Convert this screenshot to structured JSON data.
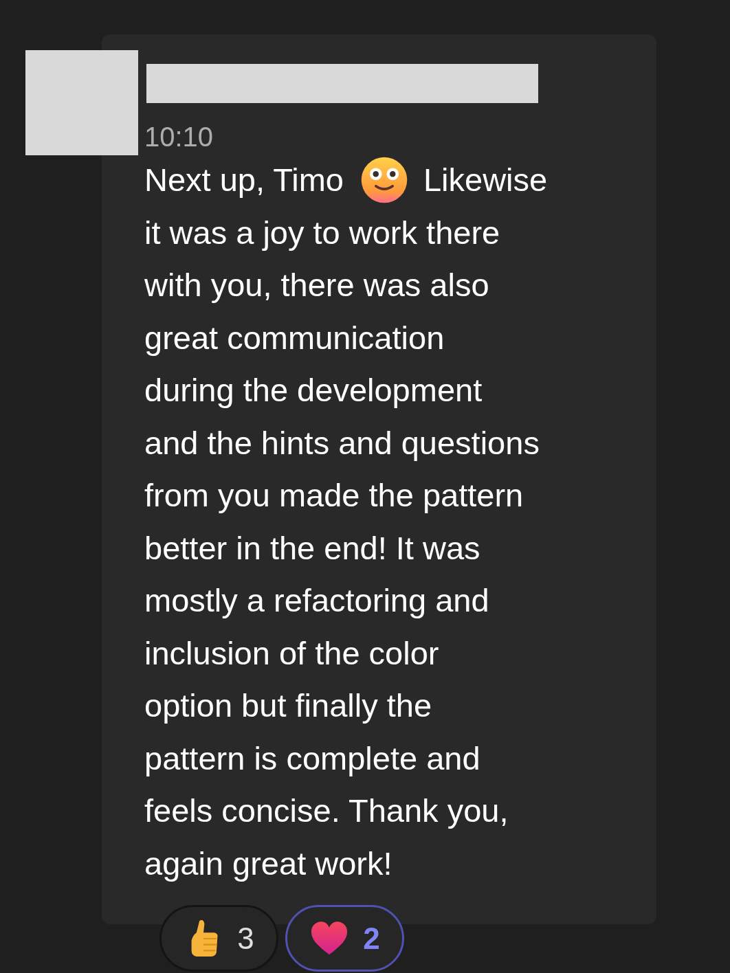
{
  "message": {
    "time": "10:10",
    "first_line_before_emoji": "Next up, Timo",
    "first_line_after_emoji": "Likewise",
    "lines": [
      "it was a joy to work there",
      "with you, there was also",
      "great communication",
      "during the development",
      "and the hints and questions",
      "from you made the pattern",
      "better in the end! It was",
      "mostly a refactoring and",
      "inclusion of the color",
      "option but finally the",
      "pattern is complete and",
      "feels concise. Thank you,",
      "again great work!"
    ]
  },
  "reactions": [
    {
      "kind": "thumbs-up",
      "count": "3",
      "selected": false
    },
    {
      "kind": "heart",
      "count": "2",
      "selected": true
    }
  ]
}
